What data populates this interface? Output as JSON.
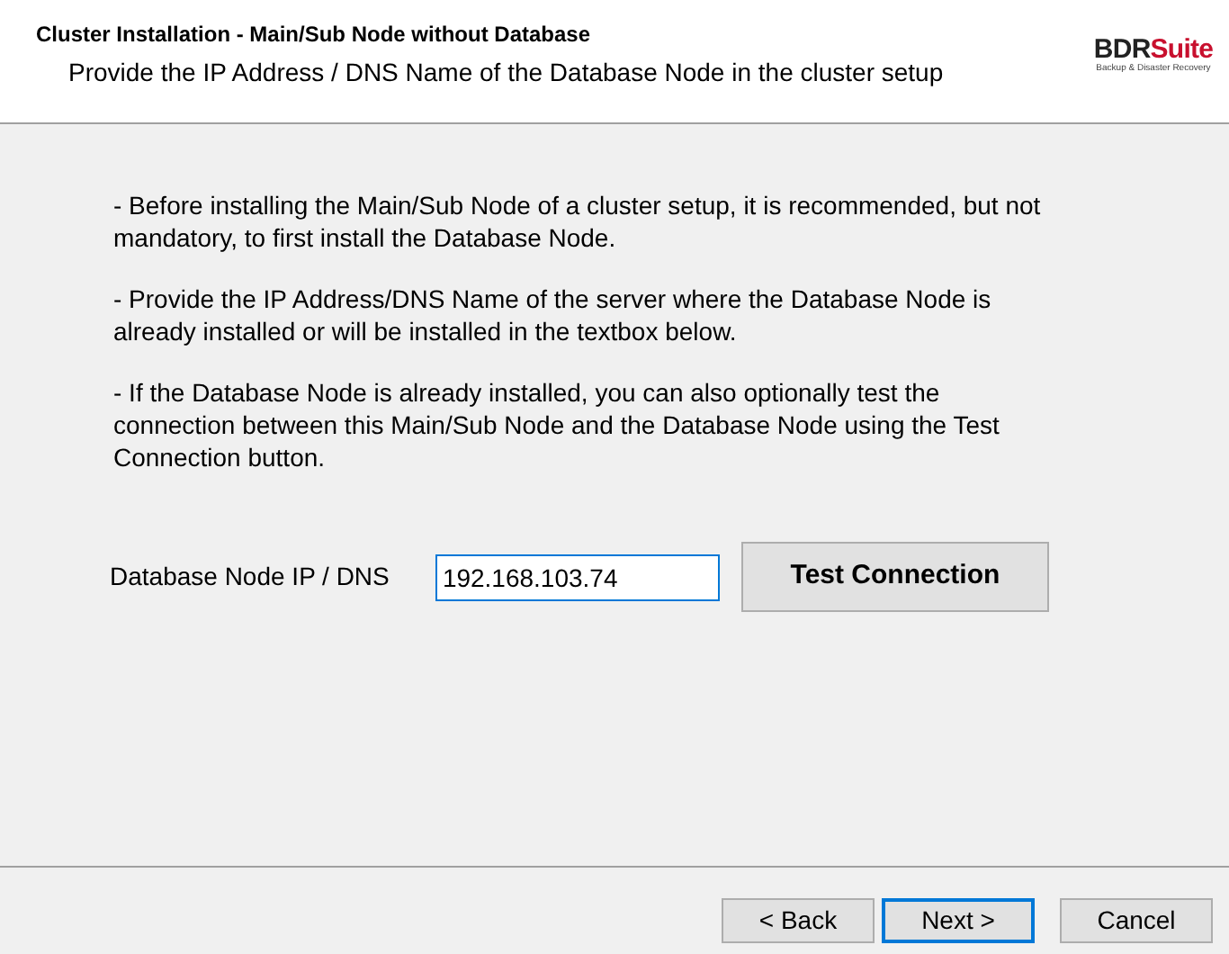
{
  "header": {
    "title": "Cluster Installation - Main/Sub Node without Database",
    "subtitle": "Provide the IP Address / DNS Name of the Database Node in the cluster setup",
    "logo": {
      "name_dark": "BDR",
      "name_accent": "Suite",
      "tagline": "Backup & Disaster Recovery"
    }
  },
  "paragraphs": [
    "- Before installing the Main/Sub Node of a cluster setup, it is recommended, but not mandatory, to first install the Database Node.",
    "- Provide the IP Address/DNS Name of the server where the Database Node is already installed or will be installed in the textbox below.",
    "- If the Database Node is already installed, you can also optionally test the connection between this Main/Sub Node and the Database Node using the Test Connection button."
  ],
  "field": {
    "label": "Database Node IP / DNS",
    "value": "192.168.103.74",
    "focused": true
  },
  "test_button": "Test Connection",
  "buttons": [
    {
      "label": "< Back",
      "focused": false
    },
    {
      "label": "Next >",
      "focused": true
    },
    {
      "label": "Cancel",
      "focused": false
    }
  ]
}
